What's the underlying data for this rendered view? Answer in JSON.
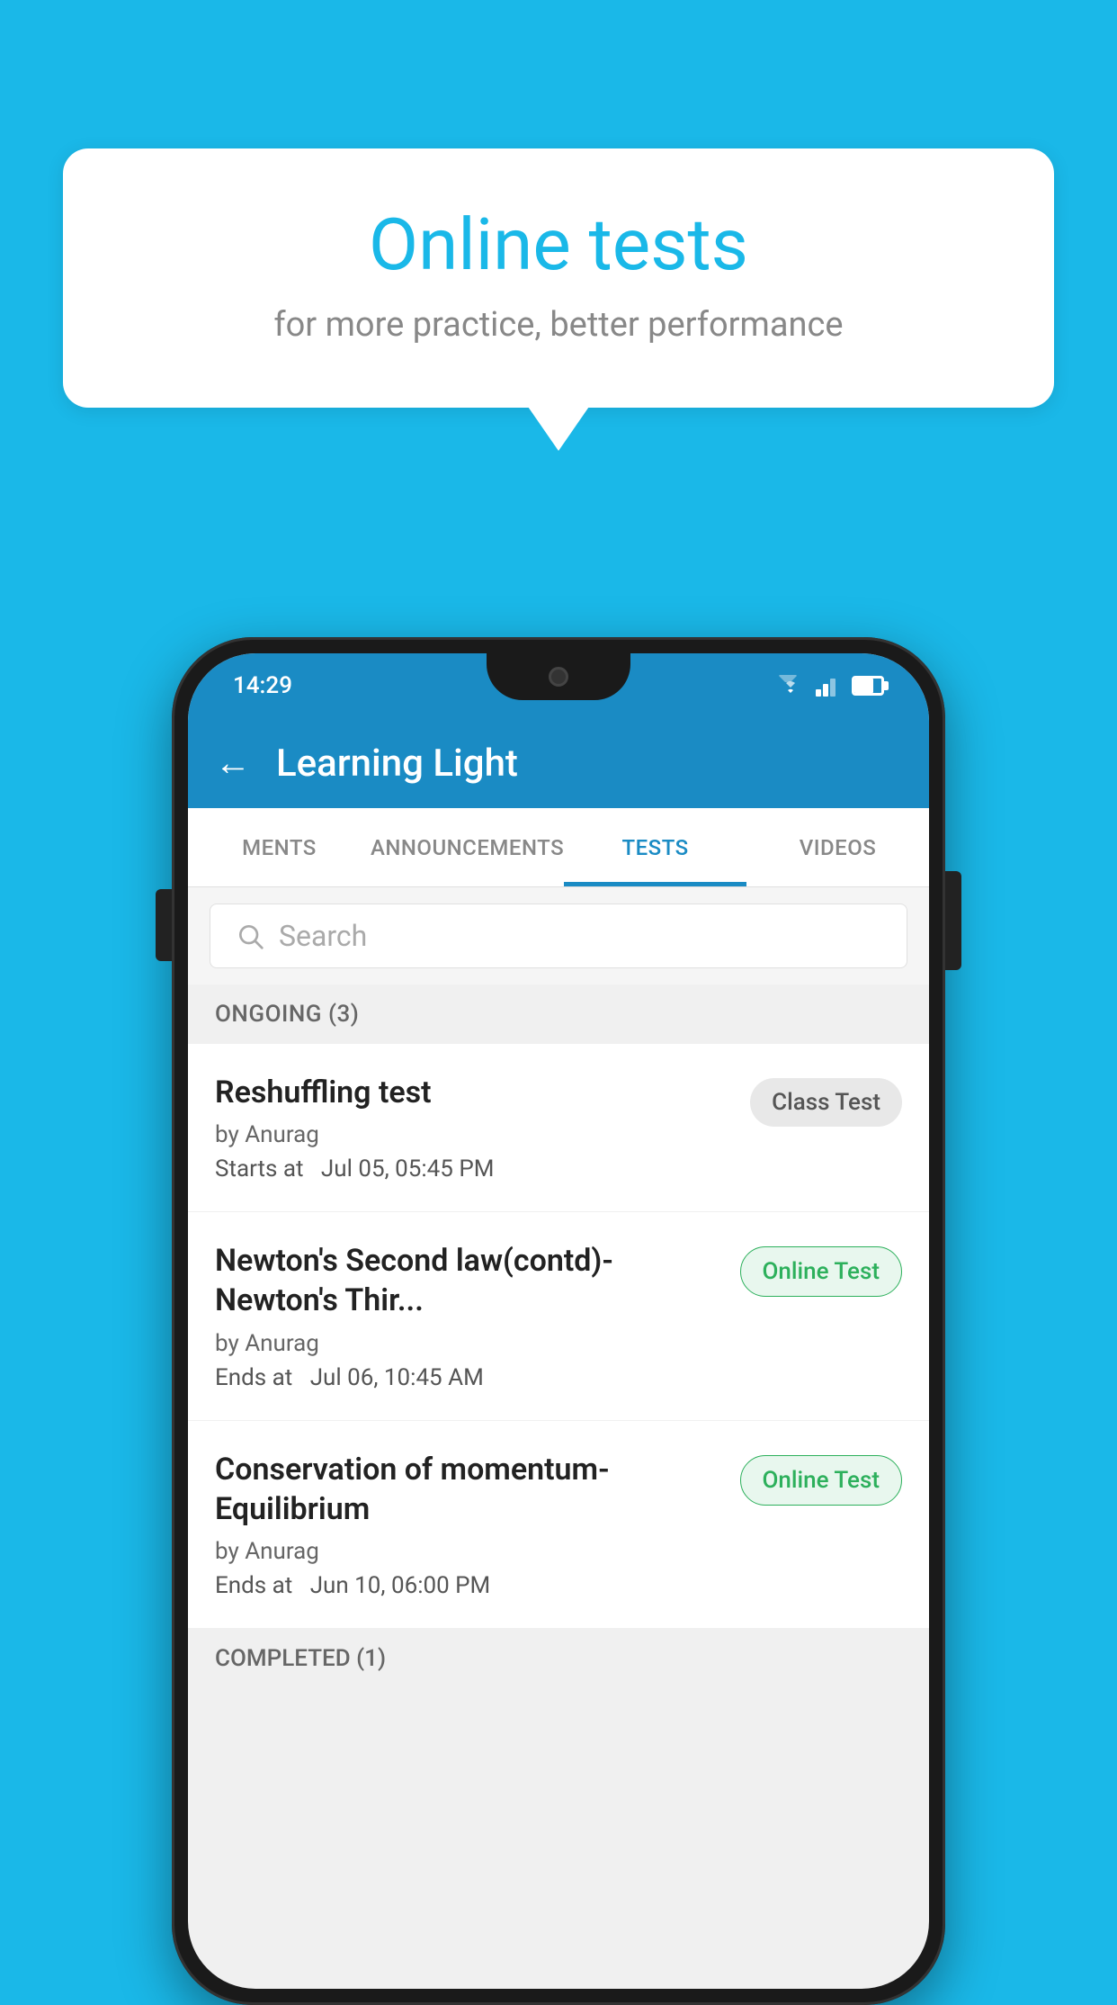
{
  "background_color": "#1ab8e8",
  "speech_bubble": {
    "title": "Online tests",
    "subtitle": "for more practice, better performance"
  },
  "status_bar": {
    "time": "14:29"
  },
  "app_bar": {
    "back_label": "←",
    "title": "Learning Light"
  },
  "tabs": [
    {
      "id": "ments",
      "label": "MENTS",
      "active": false
    },
    {
      "id": "announcements",
      "label": "ANNOUNCEMENTS",
      "active": false
    },
    {
      "id": "tests",
      "label": "TESTS",
      "active": true
    },
    {
      "id": "videos",
      "label": "VIDEOS",
      "active": false
    }
  ],
  "search": {
    "placeholder": "Search"
  },
  "section_ongoing": {
    "label": "ONGOING (3)"
  },
  "tests": [
    {
      "name": "Reshuffling test",
      "author": "by Anurag",
      "time_label": "Starts at",
      "time": "Jul 05, 05:45 PM",
      "badge": "Class Test",
      "badge_type": "class"
    },
    {
      "name": "Newton's Second law(contd)-Newton's Thir...",
      "author": "by Anurag",
      "time_label": "Ends at",
      "time": "Jul 06, 10:45 AM",
      "badge": "Online Test",
      "badge_type": "online"
    },
    {
      "name": "Conservation of momentum-Equilibrium",
      "author": "by Anurag",
      "time_label": "Ends at",
      "time": "Jun 10, 06:00 PM",
      "badge": "Online Test",
      "badge_type": "online"
    }
  ],
  "section_completed": {
    "label": "COMPLETED (1)"
  }
}
